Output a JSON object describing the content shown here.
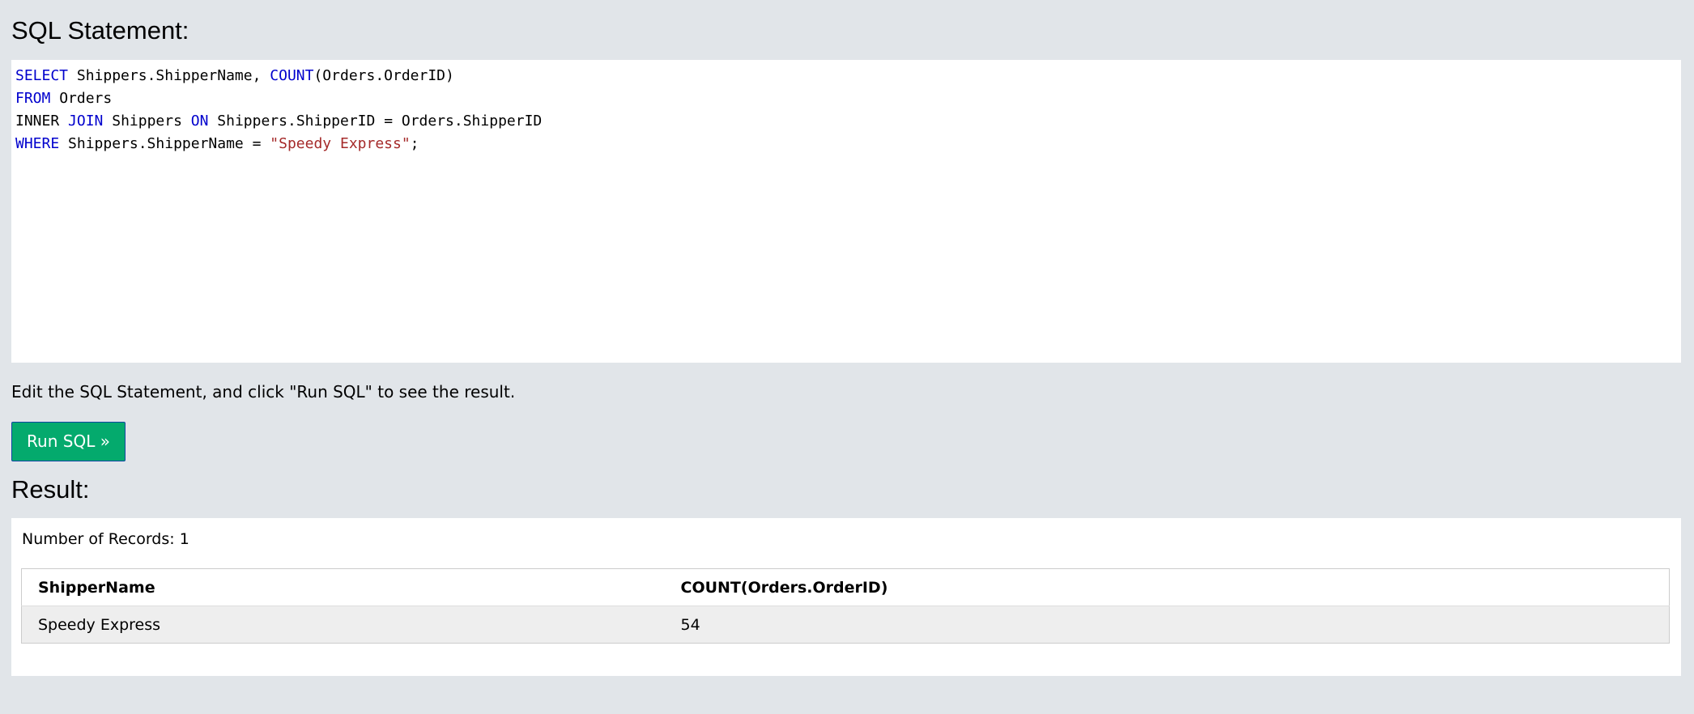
{
  "sql_section": {
    "title": "SQL Statement:",
    "code_lines": [
      [
        {
          "t": "SELECT",
          "c": "kw"
        },
        {
          "t": " Shippers.ShipperName, ",
          "c": ""
        },
        {
          "t": "COUNT",
          "c": "kw"
        },
        {
          "t": "(Orders.OrderID)",
          "c": ""
        }
      ],
      [
        {
          "t": "FROM",
          "c": "kw"
        },
        {
          "t": " Orders",
          "c": ""
        }
      ],
      [
        {
          "t": "INNER ",
          "c": ""
        },
        {
          "t": "JOIN",
          "c": "kw"
        },
        {
          "t": " Shippers ",
          "c": ""
        },
        {
          "t": "ON",
          "c": "kw"
        },
        {
          "t": " Shippers.ShipperID = Orders.ShipperID",
          "c": ""
        }
      ],
      [
        {
          "t": "WHERE",
          "c": "kw"
        },
        {
          "t": " Shippers.ShipperName = ",
          "c": ""
        },
        {
          "t": "\"Speedy Express\"",
          "c": "str"
        },
        {
          "t": ";",
          "c": ""
        }
      ]
    ]
  },
  "instruction": "Edit the SQL Statement, and click \"Run SQL\" to see the result.",
  "run_button": {
    "label": "Run SQL »"
  },
  "result_section": {
    "title": "Result:",
    "record_count": "Number of Records: 1",
    "columns": [
      "ShipperName",
      "COUNT(Orders.OrderID)"
    ],
    "rows": [
      [
        "Speedy Express",
        "54"
      ]
    ]
  },
  "colors": {
    "background": "#e1e5e9",
    "keyword": "#0000cd",
    "string": "#a52a2a",
    "button": "#04aa6d",
    "row_alt": "#eeeeee"
  }
}
